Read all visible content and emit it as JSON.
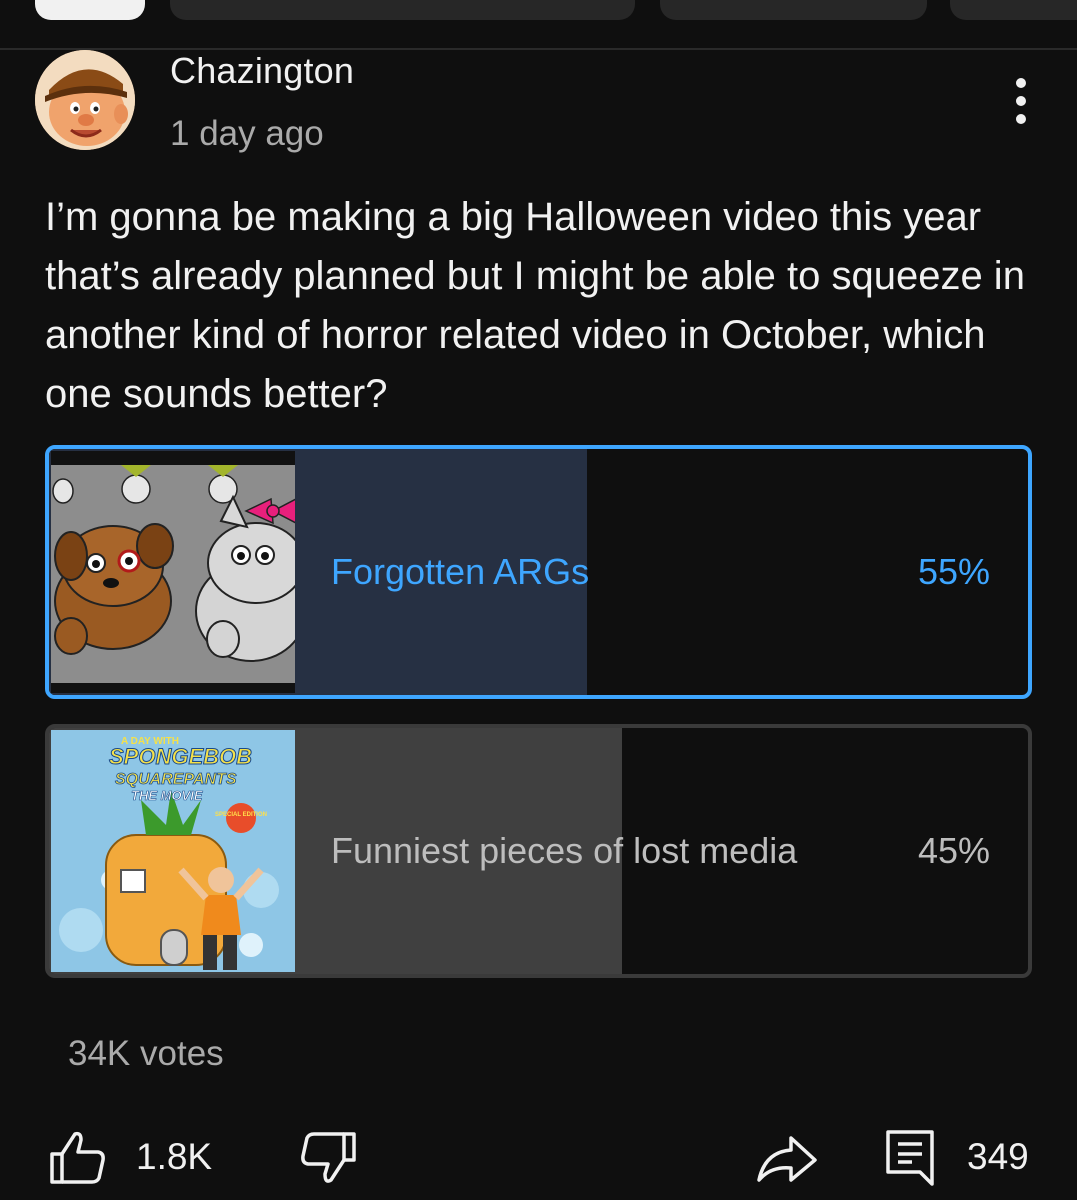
{
  "post": {
    "author": "Chazington",
    "time": "1 day ago",
    "text": "I’m gonna be making a big Halloween video this year that’s already planned but I might be able to squeeze in another kind of horror related video in October, which one sounds better?"
  },
  "poll": {
    "options": [
      {
        "label": "Forgotten ARGs",
        "percent_label": "55%",
        "percent": 55,
        "selected": true
      },
      {
        "label": "Funniest pieces of lost media",
        "percent_label": "45%",
        "percent": 45,
        "selected": false
      }
    ],
    "thumbnail_2_text": {
      "top": "A DAY WITH",
      "line1": "SPONGEBOB",
      "line2": "SQUAREPANTS",
      "line3": "THE MOVIE",
      "badge": "SPECIAL EDITION"
    },
    "votes": "34K votes"
  },
  "actions": {
    "likes": "1.8K",
    "comments": "349"
  },
  "colors": {
    "background": "#0f0f0f",
    "accent": "#3ea6ff"
  },
  "icons": [
    "more-vert-icon",
    "thumbs-up-icon",
    "thumbs-down-icon",
    "share-icon",
    "comment-icon"
  ]
}
